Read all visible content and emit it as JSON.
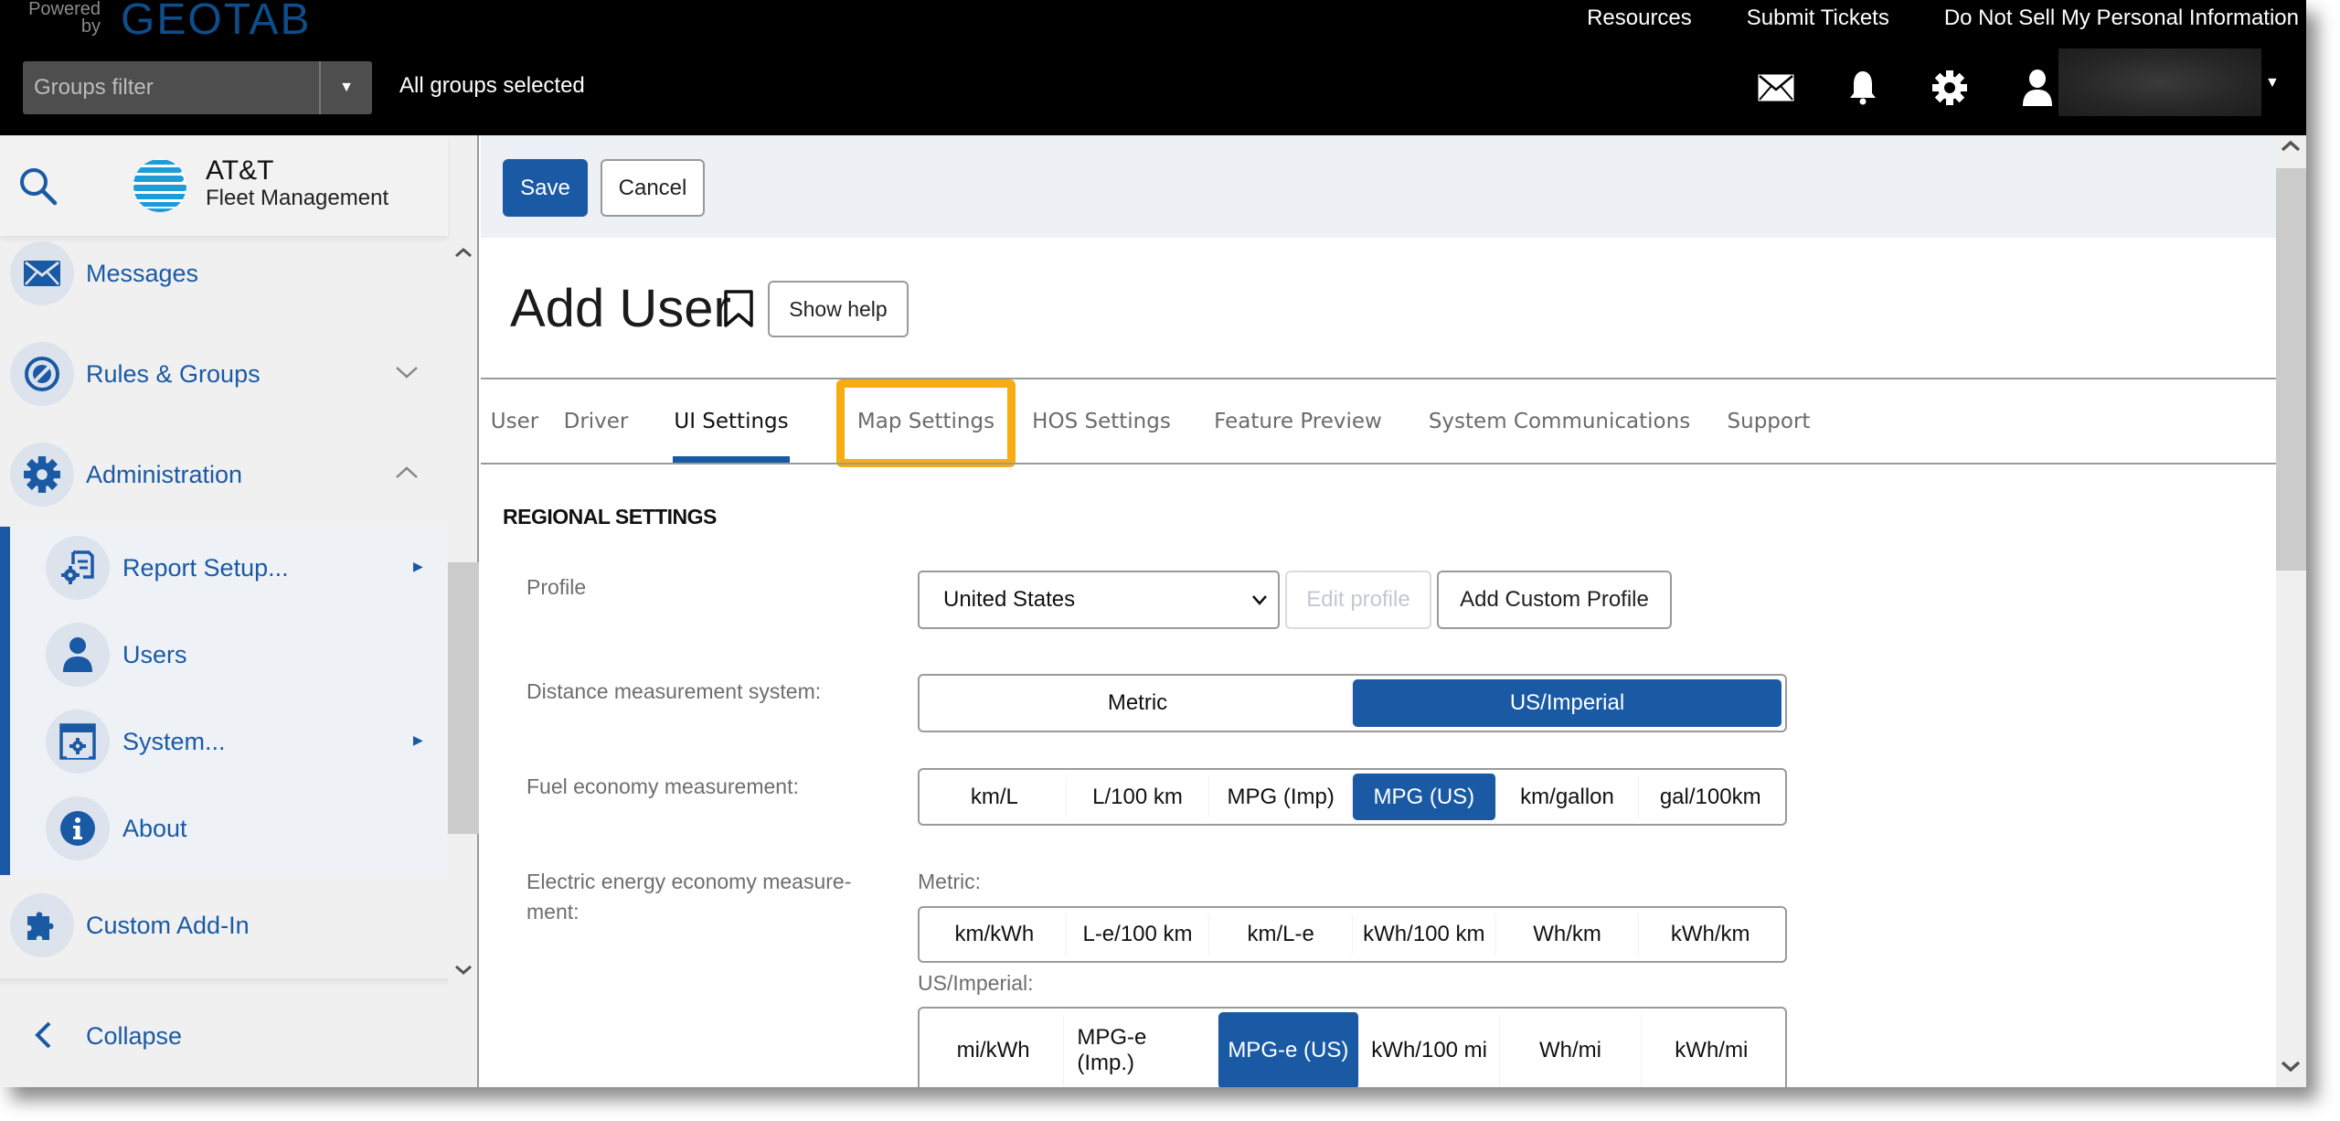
{
  "topbar": {
    "powered_by": "Powered by",
    "brand": "GEOTAB",
    "links": [
      "Resources",
      "Submit Tickets",
      "Do Not Sell My Personal Information"
    ],
    "groups_filter_placeholder": "Groups filter",
    "groups_status": "All groups selected",
    "icons": [
      "mail-icon",
      "bell-icon",
      "gear-icon",
      "user-icon"
    ]
  },
  "sidebar": {
    "logo_name": "AT&T",
    "logo_subtitle": "Fleet Management",
    "items": [
      {
        "label": "Messages",
        "icon": "envelope-icon"
      },
      {
        "label": "Rules & Groups",
        "icon": "rules-icon",
        "expanded": false
      },
      {
        "label": "Administration",
        "icon": "gear-icon",
        "expanded": true
      },
      {
        "label": "Custom Add-In",
        "icon": "puzzle-icon"
      }
    ],
    "sub_items": [
      {
        "label": "Report Setup...",
        "icon": "report-setup-icon",
        "has_submenu": true
      },
      {
        "label": "Users",
        "icon": "user-icon",
        "has_submenu": false
      },
      {
        "label": "System...",
        "icon": "system-settings-icon",
        "has_submenu": true
      },
      {
        "label": "About",
        "icon": "info-icon",
        "has_submenu": false
      }
    ],
    "collapse_label": "Collapse"
  },
  "toolbar": {
    "save_label": "Save",
    "cancel_label": "Cancel"
  },
  "page": {
    "title": "Add User",
    "show_help_label": "Show help"
  },
  "tabs": [
    {
      "label": "User",
      "active": false
    },
    {
      "label": "Driver",
      "active": false
    },
    {
      "label": "UI Settings",
      "active": true
    },
    {
      "label": "Map Settings",
      "active": false,
      "highlighted": true
    },
    {
      "label": "HOS Settings",
      "active": false
    },
    {
      "label": "Feature Preview",
      "active": false
    },
    {
      "label": "System Communications",
      "active": false
    },
    {
      "label": "Support",
      "active": false
    }
  ],
  "highlight_color": "#f7ac12",
  "accent_color": "#1a5aa5",
  "regional": {
    "section_title": "REGIONAL SETTINGS",
    "profile_label": "Profile",
    "profile_value": "United States",
    "edit_profile_label": "Edit profile",
    "add_custom_profile_label": "Add Custom Profile",
    "distance_label": "Distance measurement system:",
    "distance_options": [
      "Metric",
      "US/Imperial"
    ],
    "distance_selected": "US/Imperial",
    "fuel_label": "Fuel economy measurement:",
    "fuel_options": [
      "km/L",
      "L/100 km",
      "MPG (Imp)",
      "MPG (US)",
      "km/gallon",
      "gal/100km"
    ],
    "fuel_selected": "MPG (US)",
    "electric_label": "Electric energy economy measure-ment:",
    "electric_metric_label": "Metric:",
    "electric_metric_options": [
      "km/kWh",
      "L-e/100 km",
      "km/L-e",
      "kWh/100 km",
      "Wh/km",
      "kWh/km"
    ],
    "electric_metric_selected": null,
    "electric_us_label": "US/Imperial:",
    "electric_us_options": [
      "mi/kWh",
      "MPG-e (Imp.)",
      "MPG-e (US)",
      "kWh/100 mi",
      "Wh/mi",
      "kWh/mi"
    ],
    "electric_us_selected": "MPG-e (US)"
  }
}
